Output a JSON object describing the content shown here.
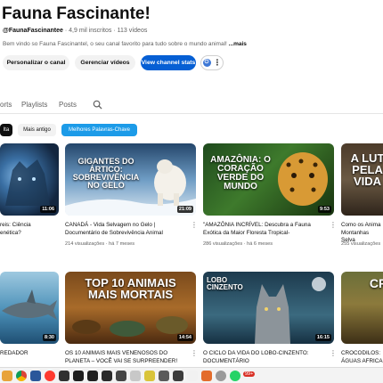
{
  "channel": {
    "title": "Fauna Fascinante!",
    "handle": "@FaunaFascinantee",
    "subscribers": "4,9 mil inscritos",
    "videos_count": "113 vídeos",
    "description": "Bem vindo so Fauna Fascinantel, o seu canal favorito para tudo sobre o mundo animal!",
    "more": "...mais"
  },
  "actions": {
    "customize": "Personalizar o canal",
    "manage": "Gerenciar vídeos",
    "stats": "View channel stats"
  },
  "tabs": [
    "orts",
    "Playlists",
    "Posts"
  ],
  "chips": [
    "lta",
    "Mais antigo",
    "Melhores Palavras-Chave"
  ],
  "videos": [
    {
      "overlay": "",
      "duration": "11:06",
      "title_l1": "reis: Ciência",
      "title_l2": "enética?",
      "meta": ""
    },
    {
      "overlay": "GIGANTES DO ÁRTICO: SOBREVIVÊNCIA NO GELO",
      "duration": "21:09",
      "title_l1": "CANADÁ - Vida Selvagem no Gelo |",
      "title_l2": "Documentário de Sobrevivência Animal",
      "meta": "214 visualizações · há 7 meses"
    },
    {
      "overlay": "AMAZÔNIA: O CORAÇÃO VERDE DO MUNDO",
      "duration": "9:53",
      "title_l1": "\"AMAZÔNIA INCRÍVEL: Descubra a Fauna",
      "title_l2": "Exótica da Maior Floresta Tropical-",
      "meta": "286 visualizações · há 6 meses"
    },
    {
      "overlay": "A LUT PELA VIDA",
      "duration": "",
      "title_l1": "Como os Anima",
      "title_l2": "Montanhas Selva",
      "meta": "255 visualizações"
    },
    {
      "overlay": "",
      "duration": "8:30",
      "title_l1": "REDADOR",
      "title_l2": "",
      "meta": ""
    },
    {
      "overlay": "TOP 10 ANIMAIS MAIS MORTAIS",
      "duration": "14:54",
      "title_l1": "OS 10 ANIMAIS MAIS VENENOSOS DO",
      "title_l2": "PLANETA – VOCÊ VAI SE SURPREENDER!",
      "meta": ""
    },
    {
      "overlay": "LOBO CINZENTO",
      "duration": "16:15",
      "title_l1": "O CICLO DA VIDA DO LOBO-CINZENTO:",
      "title_l2": "DOCUMENTÁRIO",
      "meta": ""
    },
    {
      "overlay": "CR",
      "duration": "",
      "title_l1": "CROCODILOS:",
      "title_l2": "ÁGUAS AFRICA",
      "meta": ""
    }
  ],
  "taskbar": {
    "badge": "99+"
  },
  "colors": {
    "accent": "#065fd4",
    "chip_selected": "#1c9be8"
  }
}
